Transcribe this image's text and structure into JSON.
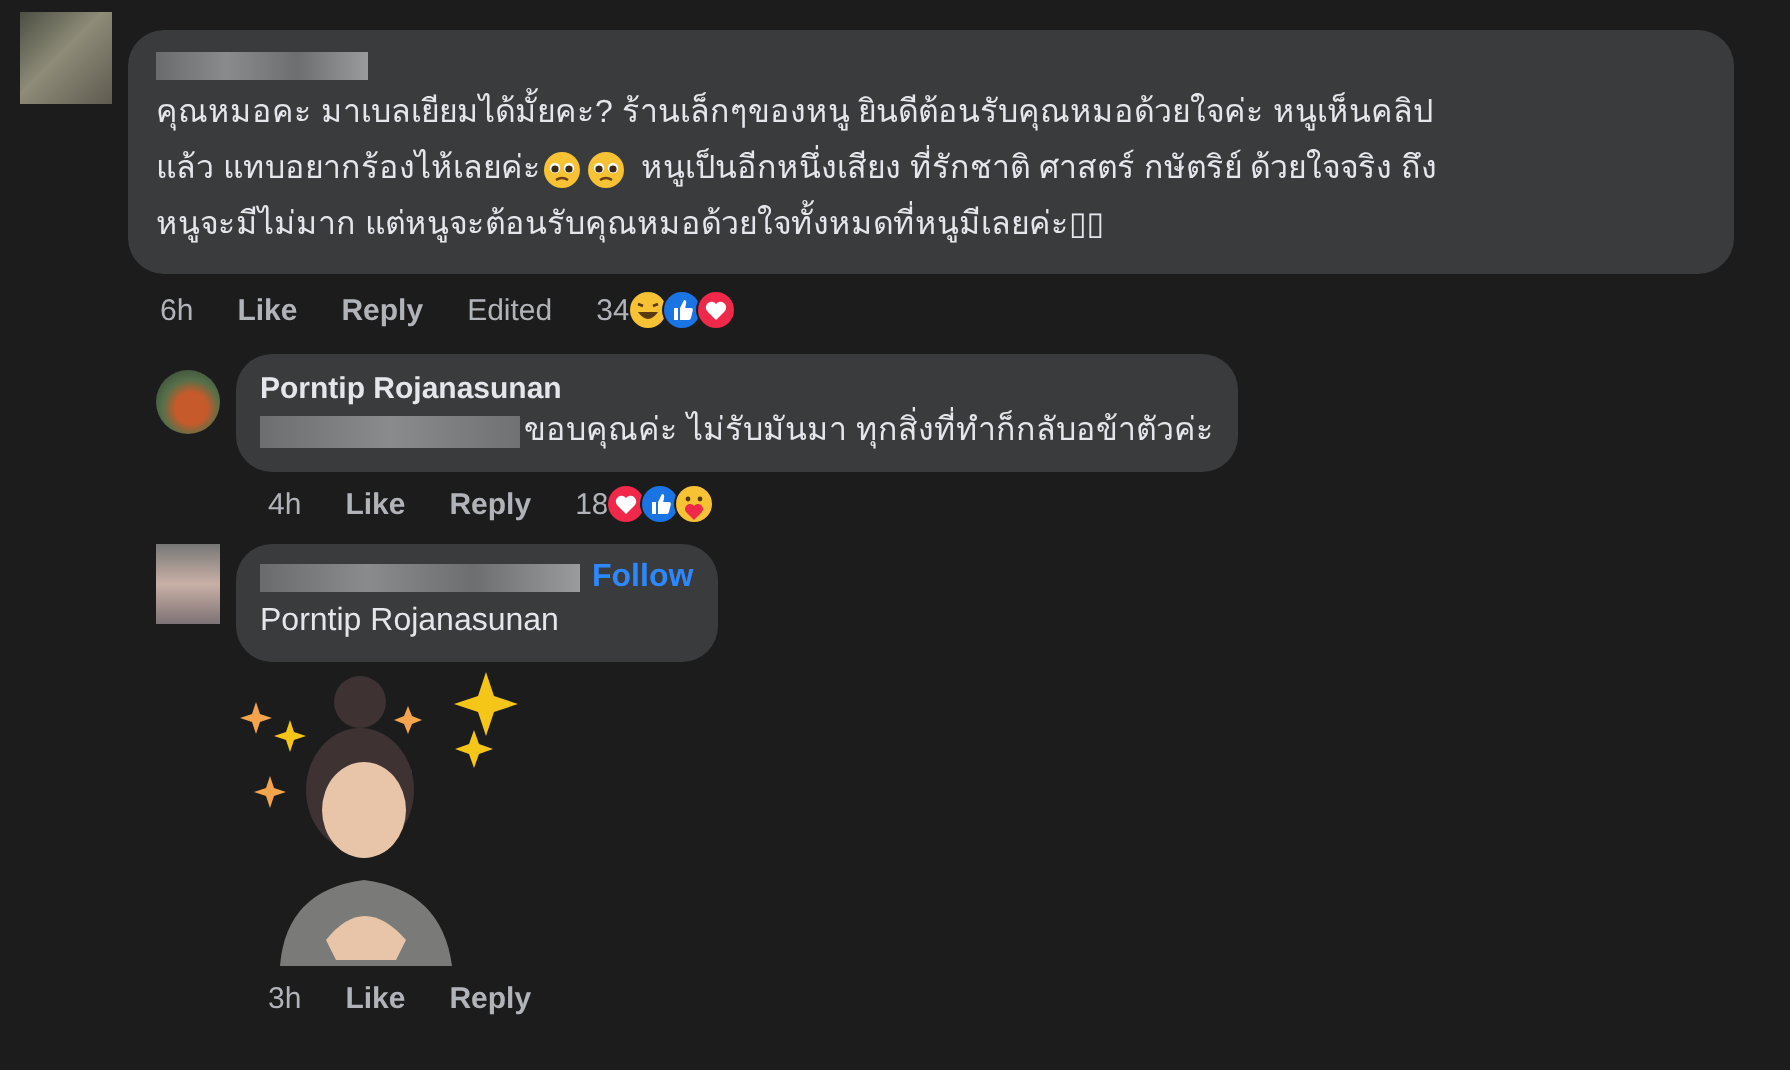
{
  "comments": [
    {
      "kind": "comment",
      "avatar": {
        "kind": "blurred"
      },
      "author_hidden": true,
      "lines": [
        [
          {
            "kind": "text",
            "text": "คุณหมอคะ มาเบลเยียมได้มั้ยคะ? ร้านเล็กๆของหนู ยินดีต้อนรับคุณหมอด้วยใจค่ะ หนูเห็นคลิป"
          }
        ],
        [
          {
            "kind": "text",
            "text": "แล้ว แทบอยากร้องไห้เลยค่ะ"
          },
          {
            "kind": "emoji"
          },
          {
            "kind": "emoji"
          },
          {
            "kind": "text",
            "text": "หนูเป็นอีกหนึ่งเสียง ที่รักชาติ ศาสตร์ กษัตริย์ ด้วยใจจริง ถึง"
          }
        ],
        [
          {
            "kind": "text",
            "text": "หนูจะมีไม่มาก แต่หนูจะต้อนรับคุณหมอด้วยใจทั้งหมดที่หนูมีเลยค่ะ▯▯"
          }
        ]
      ],
      "time": "6h",
      "like": "Like",
      "reply": "Reply",
      "edited": "Edited",
      "reactions": {
        "count": "34",
        "icons": [
          {
            "kind": "haha"
          },
          {
            "kind": "like"
          },
          {
            "kind": "love"
          }
        ]
      }
    },
    {
      "kind": "reply",
      "avatar": {
        "kind": "photo"
      },
      "author": "Porntip Rojanasunan",
      "mention_hidden": true,
      "lines": [
        [
          {
            "kind": "text",
            "text": "ขอบคุณค่ะ ไม่รับมันมา ทุกสิ่งที่ทำก็กลับอข้าตัวค่ะ"
          }
        ]
      ],
      "time": "4h",
      "like": "Like",
      "reply": "Reply",
      "reactions": {
        "count": "18",
        "icons": [
          {
            "kind": "love"
          },
          {
            "kind": "like"
          },
          {
            "kind": "care"
          }
        ]
      }
    },
    {
      "kind": "reply",
      "avatar": {
        "kind": "blurred"
      },
      "author_hidden": true,
      "follow": "Follow",
      "lines": [
        [
          {
            "kind": "text",
            "text": "Porntip Rojanasunan"
          }
        ]
      ],
      "sticker": true,
      "time": "3h",
      "like": "Like",
      "reply": "Reply"
    }
  ]
}
